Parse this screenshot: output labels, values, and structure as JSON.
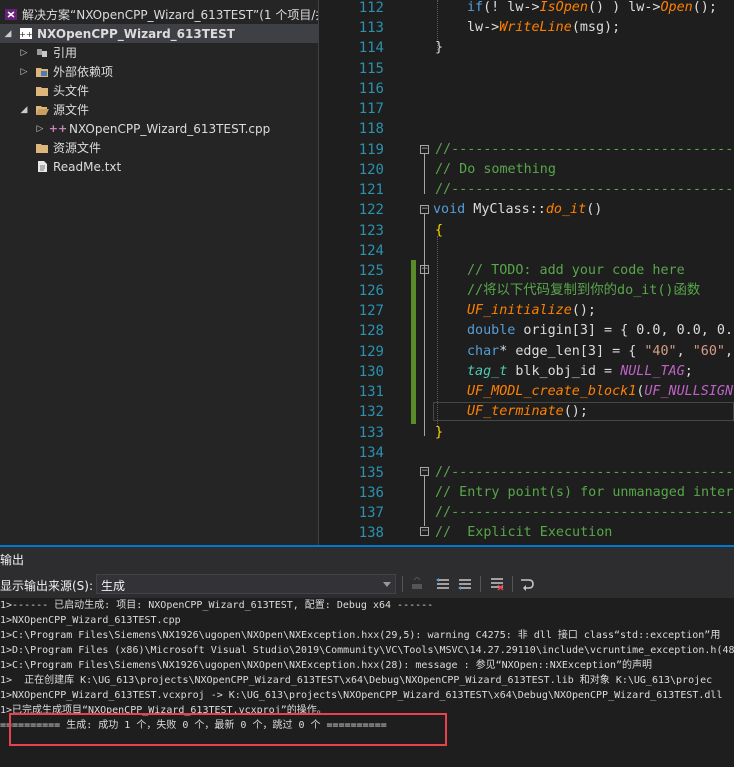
{
  "solution_explorer": {
    "items": [
      {
        "label": "解决方案“NXOpenCPP_Wizard_613TEST”(1 个项目/共",
        "icon": "solution-icon"
      },
      {
        "label": "NXOpenCPP_Wizard_613TEST",
        "icon": "project-icon"
      },
      {
        "label": "引用",
        "icon": "references-icon"
      },
      {
        "label": "外部依赖项",
        "icon": "external-deps-icon"
      },
      {
        "label": "头文件",
        "icon": "folder-icon"
      },
      {
        "label": "源文件",
        "icon": "folder-open-icon"
      },
      {
        "label": "NXOpenCPP_Wizard_613TEST.cpp",
        "icon": "cpp-file-icon"
      },
      {
        "label": "资源文件",
        "icon": "folder-icon"
      },
      {
        "label": "ReadMe.txt",
        "icon": "text-file-icon"
      }
    ]
  },
  "editor": {
    "line_numbers": [
      "112",
      "113",
      "114",
      "115",
      "116",
      "117",
      "118",
      "119",
      "120",
      "121",
      "122",
      "123",
      "124",
      "125",
      "126",
      "127",
      "128",
      "129",
      "130",
      "131",
      "132",
      "133",
      "134",
      "135",
      "136",
      "137",
      "138"
    ],
    "lines": {
      "l112_a": "if",
      "l112_b": "(! lw->",
      "l112_c": "IsOpen",
      "l112_d": "() ) lw->",
      "l112_e": "Open",
      "l112_f": "();",
      "l113_a": "lw->",
      "l113_b": "WriteLine",
      "l113_c": "(msg);",
      "l114": "}",
      "l119": "//---------------------------------------------------------------",
      "l120": "// Do something",
      "l121": "//---------------------------------------------------------------",
      "l122_a": "void",
      "l122_b": " MyClass::",
      "l122_c": "do_it",
      "l122_d": "()",
      "l123": "{",
      "l125": "// TODO: add your code here",
      "l126": "//将以下代码复制到你的do_it()函数",
      "l127_a": "UF_initialize",
      "l127_b": "();",
      "l128_a": "double",
      "l128_b": " origin[3] = { 0.0, 0.0, 0.",
      "l129_a": "char",
      "l129_b": "* edge_len[3] = { ",
      "l129_c": "\"40\"",
      "l129_d": ", ",
      "l129_e": "\"60\"",
      "l129_f": ",",
      "l130_a": "tag_t",
      "l130_b": " blk_obj_id = ",
      "l130_c": "NULL_TAG",
      "l130_d": ";",
      "l131_a": "UF_MODL_create_block1",
      "l131_b": "(",
      "l131_c": "UF_NULLSIGN",
      "l132_a": "UF_terminate",
      "l132_b": "();",
      "l133": "}",
      "l135": "//---------------------------------------------------------------",
      "l136": "// Entry point(s) for unmanaged inter",
      "l137": "//---------------------------------------------------------------",
      "l138": "//  Explicit Execution"
    }
  },
  "output": {
    "title": "输出",
    "source_label": "显示输出来源(S):",
    "source_value": "生成",
    "lines": [
      "1>------ 已启动生成: 项目: NXOpenCPP_Wizard_613TEST, 配置: Debug x64 ------",
      "1>NXOpenCPP_Wizard_613TEST.cpp",
      "1>C:\\Program Files\\Siemens\\NX1926\\ugopen\\NXOpen\\NXException.hxx(29,5): warning C4275: 非 dll 接口 class“std::exception”用",
      "1>D:\\Program Files (x86)\\Microsoft Visual Studio\\2019\\Community\\VC\\Tools\\MSVC\\14.27.29110\\include\\vcruntime_exception.h(48",
      "1>C:\\Program Files\\Siemens\\NX1926\\ugopen\\NXOpen\\NXException.hxx(28): message : 参见“NXOpen::NXException”的声明",
      "1>  正在创建库 K:\\UG_613\\projects\\NXOpenCPP_Wizard_613TEST\\x64\\Debug\\NXOpenCPP_Wizard_613TEST.lib 和对象 K:\\UG_613\\projec",
      "1>NXOpenCPP_Wizard_613TEST.vcxproj -> K:\\UG_613\\projects\\NXOpenCPP_Wizard_613TEST\\x64\\Debug\\NXOpenCPP_Wizard_613TEST.dll",
      "1>已完成生成项目“NXOpenCPP_Wizard_613TEST.vcxproj”的操作。",
      "========== 生成: 成功 1 个，失败 0 个，最新 0 个，跳过 0 个 =========="
    ]
  },
  "colors": {
    "accent": "#007acc",
    "highlight_border": "#e8434c",
    "change_bar": "#5a8d2a"
  }
}
